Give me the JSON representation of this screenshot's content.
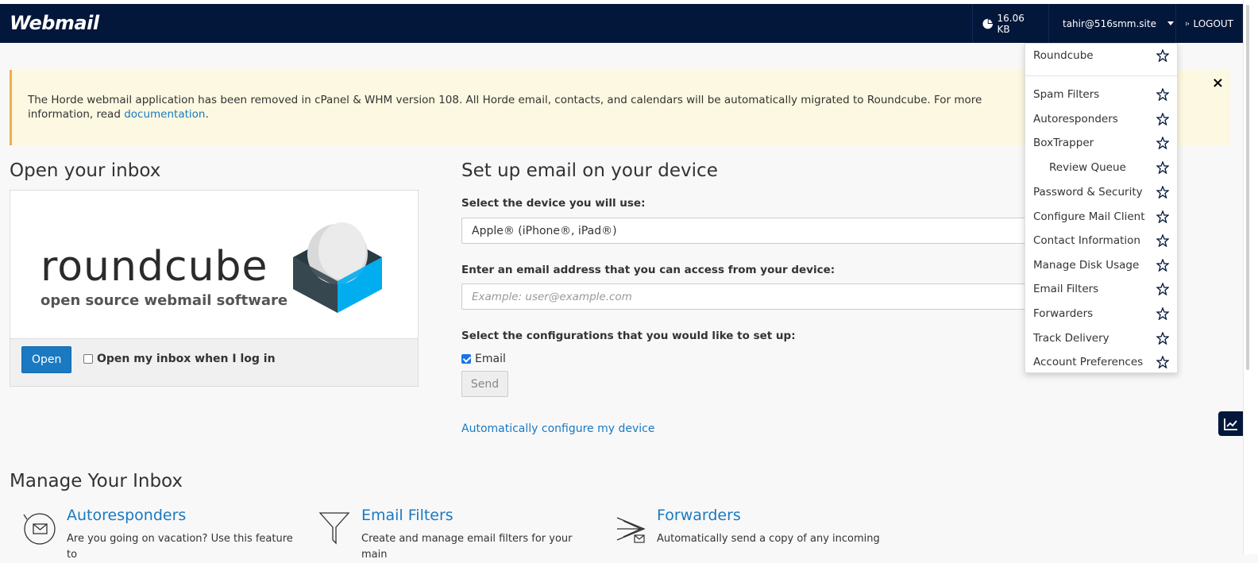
{
  "header": {
    "logo": "Webmail",
    "disk_usage": "16.06 KB",
    "user": "tahir@516smm.site",
    "logout": "LOGOUT"
  },
  "alert": {
    "text": "The Horde webmail application has been removed in cPanel & WHM version 108. All Horde email, contacts, and calendars will be automatically migrated to Roundcube. For more information, read",
    "link": "documentation",
    "tail": "."
  },
  "inbox": {
    "title": "Open your inbox",
    "logo_word": "roundcube",
    "logo_tagline": "open source webmail software",
    "open_button": "Open",
    "open_on_login_label": "Open my inbox when I log in",
    "open_on_login_checked": false
  },
  "setup": {
    "title": "Set up email on your device",
    "device_label": "Select the device you will use:",
    "device_value": "Apple® (iPhone®, iPad®)",
    "email_label": "Enter an email address that you can access from your device:",
    "email_placeholder": "Example: user@example.com",
    "config_label": "Select the configurations that you would like to set up:",
    "email_option": "Email",
    "email_option_checked": true,
    "send_button": "Send",
    "auto_link": "Automatically configure my device"
  },
  "manage": {
    "title": "Manage Your Inbox",
    "features": [
      {
        "title": "Autoresponders",
        "desc": "Are you going on vacation? Use this feature to",
        "icon": "autoresponder-icon"
      },
      {
        "title": "Email Filters",
        "desc": "Create and manage email filters for your main",
        "icon": "funnel-icon"
      },
      {
        "title": "Forwarders",
        "desc": "Automatically send a copy of any incoming",
        "icon": "forward-mail-icon"
      }
    ]
  },
  "dropdown": {
    "items": [
      "Roundcube",
      "Spam Filters",
      "Autoresponders",
      "BoxTrapper",
      "Review Queue",
      "Password & Security",
      "Configure Mail Client",
      "Contact Information",
      "Manage Disk Usage",
      "Email Filters",
      "Forwarders",
      "Track Delivery",
      "Account Preferences"
    ]
  },
  "colors": {
    "header_bg": "#03173a",
    "link": "#1a79c1",
    "alert_bg": "#fcf8e1",
    "alert_border": "#f0ad4e"
  }
}
